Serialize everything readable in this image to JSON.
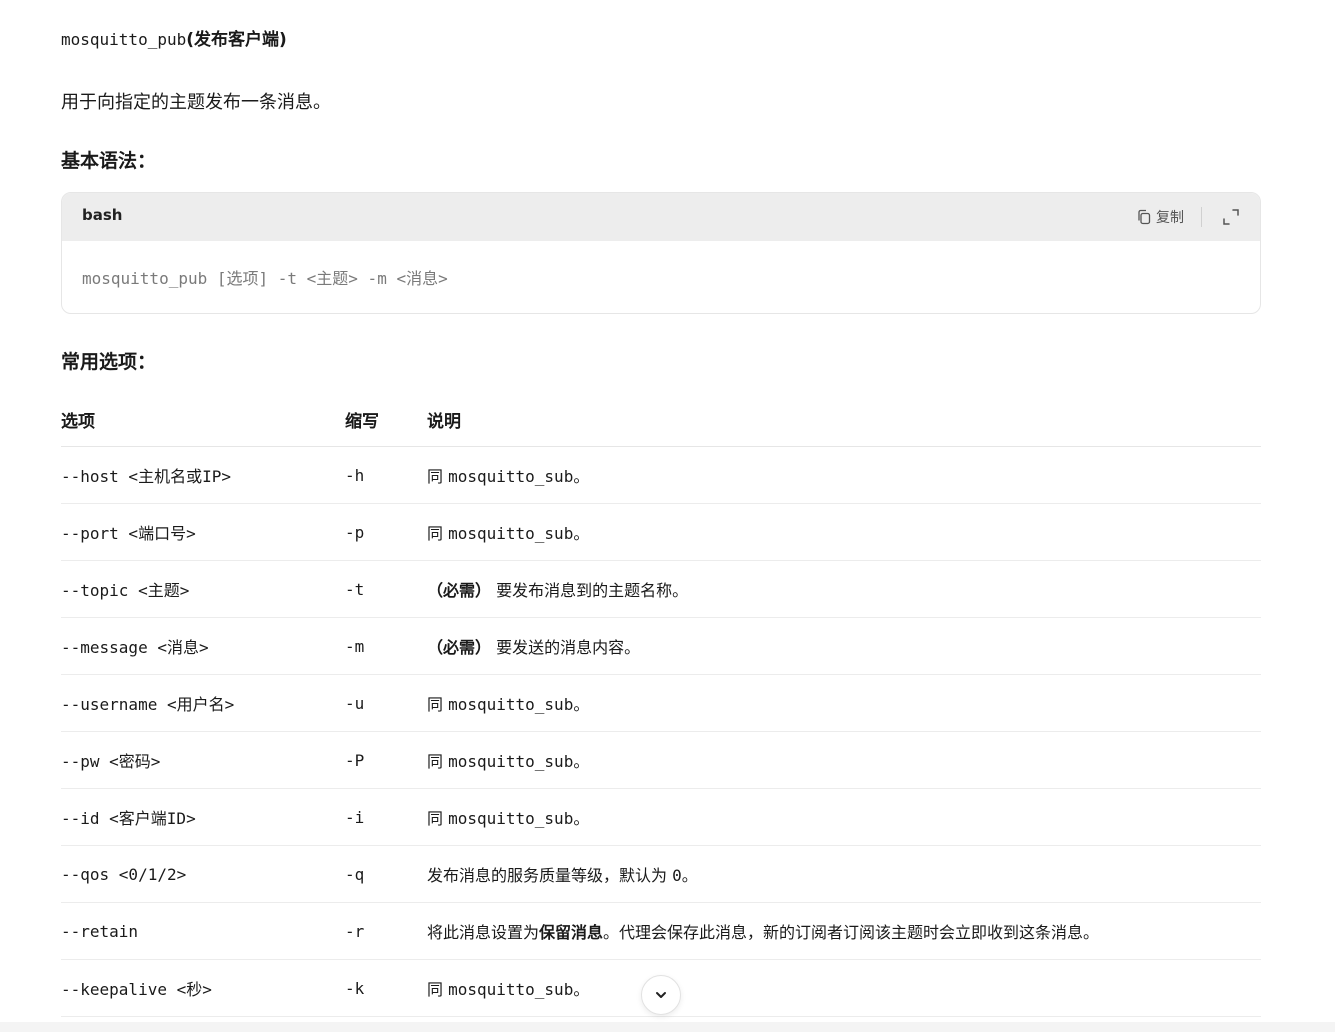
{
  "heading": {
    "command": "mosquitto_pub",
    "paren_open": "(",
    "label": "发布客户端",
    "paren_close": ")"
  },
  "intro": "用于向指定的主题发布一条消息。",
  "syntax": {
    "heading": "基本语法：",
    "lang": "bash",
    "copy_label": "复制",
    "code": "mosquitto_pub [选项] -t <主题> -m <消息>"
  },
  "options": {
    "heading": "常用选项：",
    "columns": [
      "选项",
      "缩写",
      "说明"
    ],
    "rows": [
      {
        "option": "--host <主机名或IP>",
        "short": "-h",
        "desc_pre": "同 ",
        "desc_code": "mosquitto_sub",
        "desc_post": "。"
      },
      {
        "option": "--port <端口号>",
        "short": "-p",
        "desc_pre": "同 ",
        "desc_code": "mosquitto_sub",
        "desc_post": "。"
      },
      {
        "option": "--topic <主题>",
        "short": "-t",
        "desc_bold": "（必需）",
        "desc_text": " 要发布消息到的主题名称。"
      },
      {
        "option": "--message <消息>",
        "short": "-m",
        "desc_bold": "（必需）",
        "desc_text": " 要发送的消息内容。"
      },
      {
        "option": "--username <用户名>",
        "short": "-u",
        "desc_pre": "同 ",
        "desc_code": "mosquitto_sub",
        "desc_post": "。"
      },
      {
        "option": "--pw <密码>",
        "short": "-P",
        "desc_pre": "同 ",
        "desc_code": "mosquitto_sub",
        "desc_post": "。"
      },
      {
        "option": "--id <客户端ID>",
        "short": "-i",
        "desc_pre": "同 ",
        "desc_code": "mosquitto_sub",
        "desc_post": "。"
      },
      {
        "option": "--qos <0/1/2>",
        "short": "-q",
        "desc_pre": "发布消息的服务质量等级，默认为 ",
        "desc_code": "0",
        "desc_post": "。"
      },
      {
        "option": "--retain",
        "short": "-r",
        "desc_text_a": "将此消息设置为",
        "desc_bold_mid": "保留消息",
        "desc_text_b": "。代理会保存此消息，新的订阅者订阅该主题时会立即收到这条消息。"
      },
      {
        "option": "--keepalive <秒>",
        "short": "-k",
        "desc_pre": "同 ",
        "desc_code": "mosquitto_sub",
        "desc_post": "。"
      }
    ]
  },
  "icons": {
    "copy": "copy-icon",
    "expand": "expand-icon",
    "scroll_down": "chevron-down-icon"
  }
}
